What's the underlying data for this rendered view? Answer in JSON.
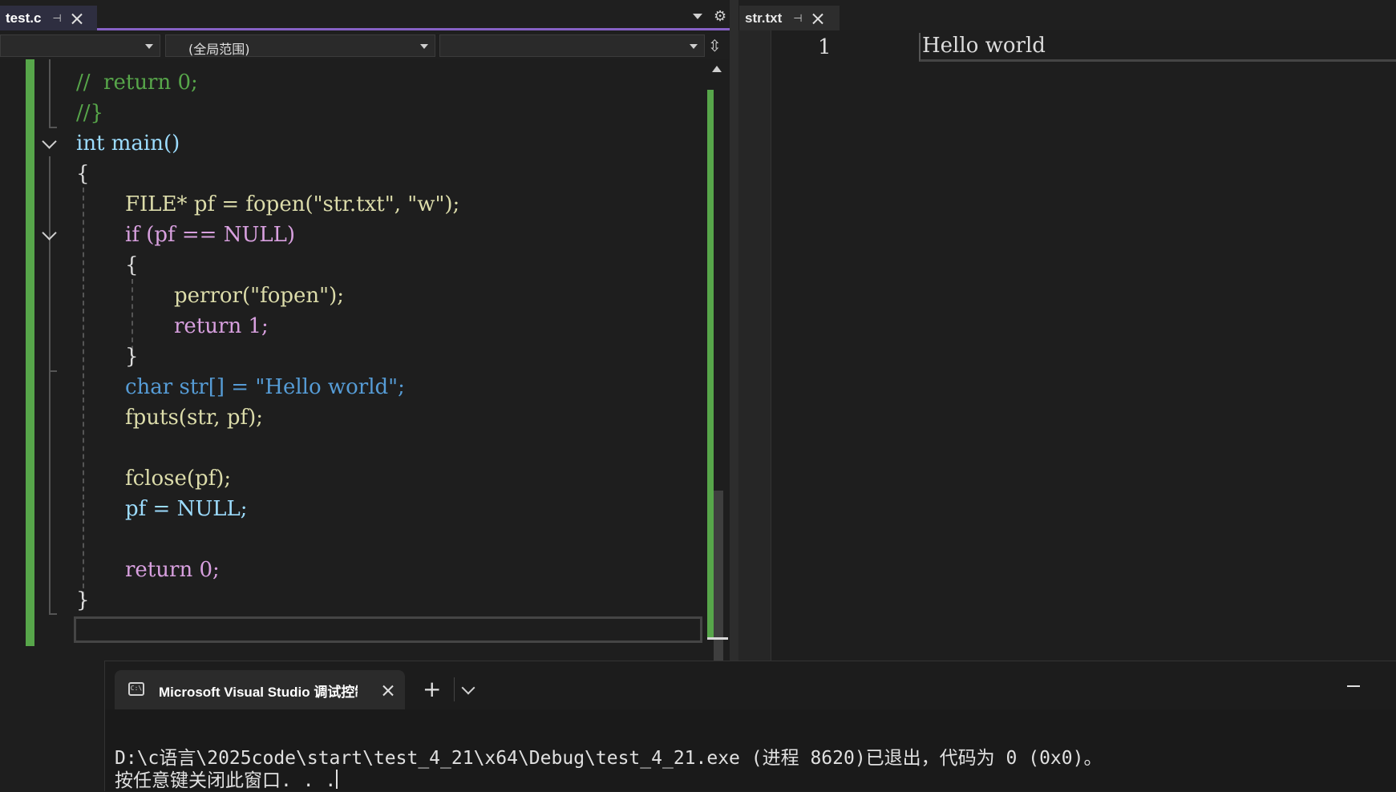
{
  "left_tabs": {
    "active_tab": "test.c",
    "pin_glyph": "⊣",
    "settings_glyph": "⚙"
  },
  "navbar": {
    "scope_label": "(全局范围)"
  },
  "code_lines": [
    {
      "text": "//  return 0;"
    },
    {
      "text": "//}"
    },
    {
      "text": "int main()"
    },
    {
      "text": "{"
    },
    {
      "text": "FILE* pf = fopen(\"str.txt\", \"w\");"
    },
    {
      "text": "if (pf == NULL)"
    },
    {
      "text": "{"
    },
    {
      "text": "perror(\"fopen\");"
    },
    {
      "text": "return 1;"
    },
    {
      "text": "}"
    },
    {
      "text": "char str[] = \"Hello world\";"
    },
    {
      "text": "fputs(str, pf);"
    },
    {
      "text": "fclose(pf);"
    },
    {
      "text": "pf = NULL;"
    },
    {
      "text": "return 0;"
    },
    {
      "text": "}"
    }
  ],
  "right_tab": {
    "name": "str.txt"
  },
  "txt_editor": {
    "line_number": "1",
    "content": "Hello world"
  },
  "terminal": {
    "tab_title": "Microsoft Visual Studio 调试控制台",
    "new_tab": "+",
    "output_line1": "D:\\c语言\\2025code\\start\\test_4_21\\x64\\Debug\\test_4_21.exe (进程 8620)已退出，代码为 0 (0x0)。",
    "output_line2": "按任意键关闭此窗口. . ."
  },
  "colors": {
    "accent": "#8661c5",
    "change_bar": "#57a64a",
    "keyword": "#569cd6",
    "control_keyword": "#d8a0df",
    "function": "#dcdcaa",
    "variable": "#9cdcfe",
    "string": "#d69d85",
    "comment": "#57a64a"
  }
}
